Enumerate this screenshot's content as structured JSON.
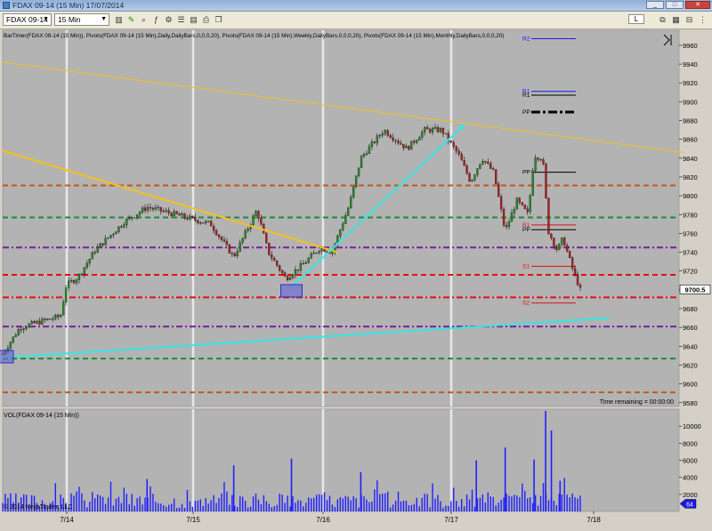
{
  "window": {
    "title": "FDAX 09-14 (15 Min)  17/07/2014",
    "controls": [
      "_",
      "□",
      "✕"
    ]
  },
  "toolbar": {
    "instrument": "FDAX 09-14",
    "interval": "15 Min",
    "small_button": "L"
  },
  "colors": {
    "background": "#b3b3b3",
    "up_candle": "#2a8a2a",
    "down_candle": "#b02020",
    "volume": "#2020ff",
    "trend_orange": "#f5c01b",
    "trend_cyan": "#35e6e6",
    "pivot_orange": "#c2571f",
    "pivot_green": "#1e8a3a",
    "pivot_purple": "#7a1f9a",
    "pivot_red": "#e01010",
    "pivot_black": "#000000",
    "pivot_blue": "#1a1ae0"
  },
  "chart_data": [
    {
      "type": "candlestick",
      "indicator_label": "BarTimer(FDAX 09-14 (15 Min)), Pivots(FDAX 09-14 (15 Min),Daily,DailyBars,0,0,0,20), Pivots(FDAX 09-14 (15 Min),Weekly,DailyBars,0,0,0,20), Pivots(FDAX 09-14 (15 Min),Monthly,DailyBars,0,0,0,20)",
      "y_axis": {
        "min": 9576,
        "max": 9976,
        "ticks": [
          9580,
          9600,
          9620,
          9640,
          9660,
          9680,
          9700,
          9720,
          9740,
          9760,
          9780,
          9800,
          9820,
          9840,
          9860,
          9880,
          9900,
          9920,
          9940,
          9960
        ]
      },
      "x_ticks": [
        "7/14",
        "7/15",
        "7/16",
        "7/17",
        "7/18"
      ],
      "last_price_label": "9700.5",
      "time_remaining": "Time remaining = 00:00:00",
      "anchors": [
        {
          "t": 0,
          "price": 9632
        },
        {
          "t": 0.03,
          "price": 9660
        },
        {
          "t": 0.07,
          "price": 9667
        },
        {
          "t": 0.1,
          "price": 9672
        },
        {
          "t": 0.11,
          "price": 9705
        },
        {
          "t": 0.13,
          "price": 9713
        },
        {
          "t": 0.16,
          "price": 9742
        },
        {
          "t": 0.21,
          "price": 9772
        },
        {
          "t": 0.25,
          "price": 9788
        },
        {
          "t": 0.3,
          "price": 9780
        },
        {
          "t": 0.36,
          "price": 9770
        },
        {
          "t": 0.4,
          "price": 9735
        },
        {
          "t": 0.44,
          "price": 9785
        },
        {
          "t": 0.46,
          "price": 9740
        },
        {
          "t": 0.49,
          "price": 9712
        },
        {
          "t": 0.52,
          "price": 9727
        },
        {
          "t": 0.55,
          "price": 9745
        },
        {
          "t": 0.57,
          "price": 9740
        },
        {
          "t": 0.6,
          "price": 9790
        },
        {
          "t": 0.62,
          "price": 9840
        },
        {
          "t": 0.66,
          "price": 9870
        },
        {
          "t": 0.7,
          "price": 9850
        },
        {
          "t": 0.73,
          "price": 9870
        },
        {
          "t": 0.76,
          "price": 9870
        },
        {
          "t": 0.79,
          "price": 9843
        },
        {
          "t": 0.81,
          "price": 9815
        },
        {
          "t": 0.83,
          "price": 9840
        },
        {
          "t": 0.85,
          "price": 9825
        },
        {
          "t": 0.87,
          "price": 9762
        },
        {
          "t": 0.89,
          "price": 9795
        },
        {
          "t": 0.91,
          "price": 9780
        },
        {
          "t": 0.92,
          "price": 9843
        },
        {
          "t": 0.935,
          "price": 9840
        },
        {
          "t": 0.945,
          "price": 9762
        },
        {
          "t": 0.96,
          "price": 9742
        },
        {
          "t": 0.97,
          "price": 9755
        },
        {
          "t": 0.985,
          "price": 9725
        },
        {
          "t": 1,
          "price": 9700
        }
      ],
      "pivot_lines": [
        {
          "price": 9811,
          "color": "pivot_orange",
          "dash": "6,4"
        },
        {
          "price": 9777,
          "color": "pivot_green",
          "dash": "6,4"
        },
        {
          "price": 9745,
          "color": "pivot_purple",
          "dash": "7,3,2,3"
        },
        {
          "price": 9716,
          "color": "pivot_red",
          "dash": "6,4"
        },
        {
          "price": 9692,
          "color": "pivot_red",
          "dash": "7,3,2,3"
        },
        {
          "price": 9661,
          "color": "pivot_purple",
          "dash": "7,3,2,3"
        },
        {
          "price": 9627,
          "color": "pivot_green",
          "dash": "6,4"
        },
        {
          "price": 9591,
          "color": "pivot_orange",
          "dash": "6,4"
        }
      ],
      "daily_pivots": [
        {
          "label": "R2",
          "price": 9967,
          "color": "pivot_blue"
        },
        {
          "label": "R1",
          "price": 9911,
          "color": "pivot_blue"
        },
        {
          "label": "R1",
          "price": 9907,
          "color": "pivot_black"
        },
        {
          "label": "PP",
          "price": 9889,
          "color": "pivot_black"
        },
        {
          "label": "PP",
          "price": 9825,
          "color": "pivot_black"
        },
        {
          "label": "R1",
          "price": 9769,
          "color": "pivot_red"
        },
        {
          "label": "PP",
          "price": 9764,
          "color": "pivot_black"
        },
        {
          "label": "S1",
          "price": 9725,
          "color": "pivot_red"
        },
        {
          "label": "S2",
          "price": 9686,
          "color": "pivot_red"
        }
      ],
      "trend_lines": [
        {
          "color": "trend_orange",
          "width": 1,
          "from": [
            0,
            9942
          ],
          "to": [
            1.18,
            9846
          ]
        },
        {
          "color": "trend_orange",
          "width": 2,
          "from": [
            0,
            9848
          ],
          "to": [
            0.58,
            9740
          ]
        },
        {
          "color": "trend_cyan",
          "width": 2,
          "from": [
            0,
            9628
          ],
          "to": [
            1.05,
            9670
          ]
        },
        {
          "color": "trend_cyan",
          "width": 2,
          "from": [
            0.5,
            9703
          ],
          "to": [
            0.8,
            9876
          ]
        }
      ],
      "highlight_boxes": [
        {
          "t": 0.5,
          "price": 9698
        },
        {
          "t": 0,
          "price": 9628
        }
      ]
    },
    {
      "type": "bar",
      "label": "VOL(FDAX 09-14 (15 Min))",
      "y_axis": {
        "min": 0,
        "max": 12000,
        "ticks": [
          2000,
          4000,
          6000,
          8000,
          10000
        ]
      },
      "last_value_label": "64",
      "copyright": "© 2014 NinjaTrader, LLC",
      "spikes": [
        {
          "t": 0.25,
          "value": 3800
        },
        {
          "t": 0.4,
          "value": 5400
        },
        {
          "t": 0.5,
          "value": 6200
        },
        {
          "t": 0.62,
          "value": 4600
        },
        {
          "t": 0.82,
          "value": 6000
        },
        {
          "t": 0.87,
          "value": 7500
        },
        {
          "t": 0.92,
          "value": 6100
        },
        {
          "t": 0.94,
          "value": 11800
        },
        {
          "t": 0.95,
          "value": 9500
        },
        {
          "t": 0.965,
          "value": 3600
        }
      ]
    }
  ]
}
